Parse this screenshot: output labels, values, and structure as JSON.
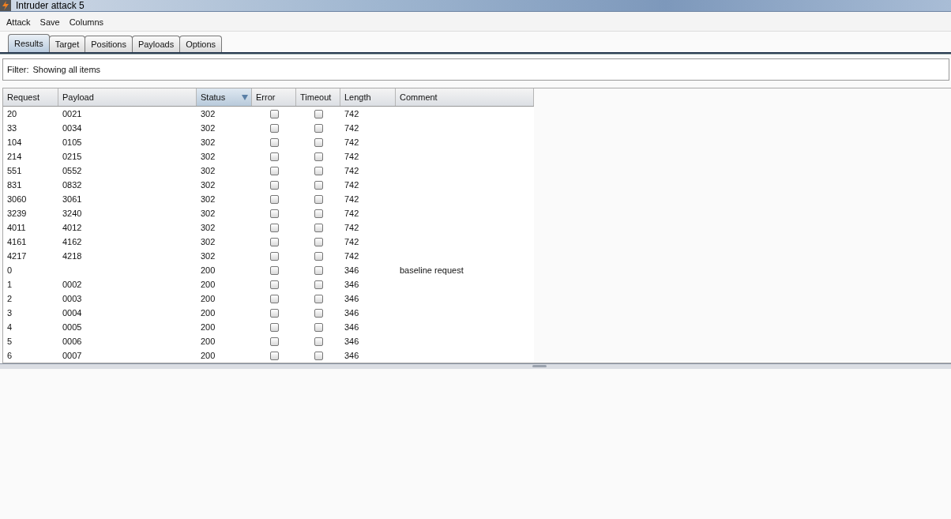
{
  "window": {
    "title": "Intruder attack 5"
  },
  "menu": [
    "Attack",
    "Save",
    "Columns"
  ],
  "tabs": [
    {
      "label": "Results",
      "selected": true
    },
    {
      "label": "Target",
      "selected": false
    },
    {
      "label": "Positions",
      "selected": false
    },
    {
      "label": "Payloads",
      "selected": false
    },
    {
      "label": "Options",
      "selected": false
    }
  ],
  "filter": {
    "label": "Filter:",
    "value": "Showing all items"
  },
  "table": {
    "columns": [
      {
        "label": "Request",
        "sorted": false
      },
      {
        "label": "Payload",
        "sorted": false
      },
      {
        "label": "Status",
        "sorted": true
      },
      {
        "label": "Error",
        "sorted": false
      },
      {
        "label": "Timeout",
        "sorted": false
      },
      {
        "label": "Length",
        "sorted": false
      },
      {
        "label": "Comment",
        "sorted": false
      }
    ],
    "rows": [
      {
        "request": "20",
        "payload": "0021",
        "status": "302",
        "error": false,
        "timeout": false,
        "length": "742"
      },
      {
        "request": "33",
        "payload": "0034",
        "status": "302",
        "error": false,
        "timeout": false,
        "length": "742"
      },
      {
        "request": "104",
        "payload": "0105",
        "status": "302",
        "error": false,
        "timeout": false,
        "length": "742"
      },
      {
        "request": "214",
        "payload": "0215",
        "status": "302",
        "error": false,
        "timeout": false,
        "length": "742"
      },
      {
        "request": "551",
        "payload": "0552",
        "status": "302",
        "error": false,
        "timeout": false,
        "length": "742"
      },
      {
        "request": "831",
        "payload": "0832",
        "status": "302",
        "error": false,
        "timeout": false,
        "length": "742"
      },
      {
        "request": "3060",
        "payload": "3061",
        "status": "302",
        "error": false,
        "timeout": false,
        "length": "742"
      },
      {
        "request": "3239",
        "payload": "3240",
        "status": "302",
        "error": false,
        "timeout": false,
        "length": "742"
      },
      {
        "request": "4011",
        "payload": "4012",
        "status": "302",
        "error": false,
        "timeout": false,
        "length": "742"
      },
      {
        "request": "4161",
        "payload": "4162",
        "status": "302",
        "error": false,
        "timeout": false,
        "length": "742"
      },
      {
        "request": "4217",
        "payload": "4218",
        "status": "302",
        "error": false,
        "timeout": false,
        "length": "742"
      },
      {
        "request": "0",
        "status": "200",
        "error": false,
        "timeout": false,
        "length": "346",
        "comment": "baseline request"
      },
      {
        "request": "1",
        "payload": "0002",
        "status": "200",
        "error": false,
        "timeout": false,
        "length": "346"
      },
      {
        "request": "2",
        "payload": "0003",
        "status": "200",
        "error": false,
        "timeout": false,
        "length": "346"
      },
      {
        "request": "3",
        "payload": "0004",
        "status": "200",
        "error": false,
        "timeout": false,
        "length": "346"
      },
      {
        "request": "4",
        "payload": "0005",
        "status": "200",
        "error": false,
        "timeout": false,
        "length": "346"
      },
      {
        "request": "5",
        "payload": "0006",
        "status": "200",
        "error": false,
        "timeout": false,
        "length": "346"
      },
      {
        "request": "6",
        "payload": "0007",
        "status": "200",
        "error": false,
        "timeout": false,
        "length": "346"
      }
    ]
  }
}
